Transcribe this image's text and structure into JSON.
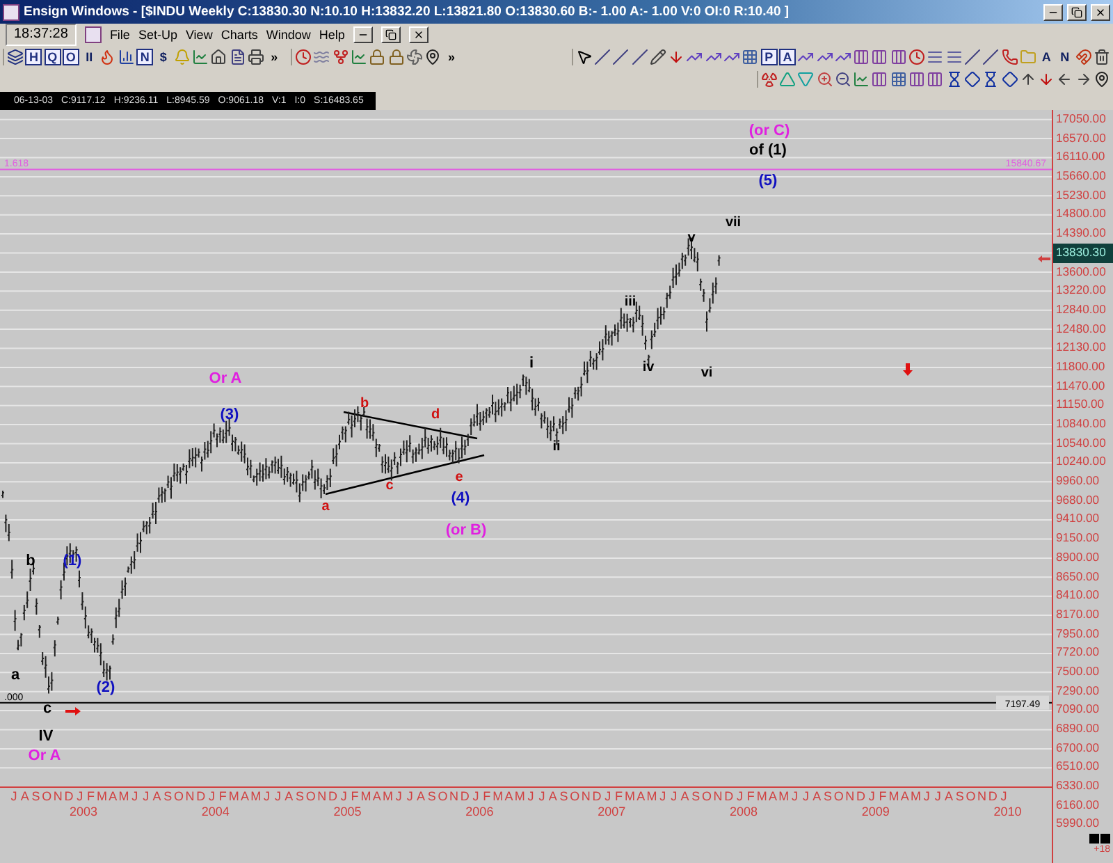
{
  "window": {
    "title": "Ensign Windows - [$INDU Weekly C:13830.30 N:10.10 H:13832.20 L:13821.80 O:13830.60 B:- 1.00 A:- 1.00 V:0 OI:0 R:10.40 ]"
  },
  "clock": "18:37:28",
  "menu": [
    "File",
    "Set-Up",
    "View",
    "Charts",
    "Window",
    "Help"
  ],
  "toolbar_1": [
    [
      {
        "kind": "window"
      },
      {
        "kind": "boxed-letter",
        "text": "H"
      },
      {
        "kind": "boxed-letter",
        "text": "Q"
      },
      {
        "kind": "boxed-letter",
        "text": "O"
      },
      {
        "kind": "letter",
        "text": "II"
      },
      {
        "kind": "flame"
      },
      {
        "kind": "bars"
      },
      {
        "kind": "boxed-letter",
        "text": "N"
      },
      {
        "kind": "letter",
        "text": "$"
      },
      {
        "kind": "bell"
      },
      {
        "kind": "chart"
      },
      {
        "kind": "home"
      },
      {
        "kind": "file"
      },
      {
        "kind": "printer"
      },
      {
        "kind": "more",
        "text": "»"
      }
    ],
    [
      {
        "kind": "clock"
      },
      {
        "kind": "waves"
      },
      {
        "kind": "fork"
      },
      {
        "kind": "chart"
      },
      {
        "kind": "lock"
      },
      {
        "kind": "lock"
      },
      {
        "kind": "fan"
      },
      {
        "kind": "pin"
      },
      {
        "kind": "more",
        "text": "»"
      }
    ],
    [
      {
        "kind": "cursor"
      },
      {
        "kind": "line"
      },
      {
        "kind": "line"
      },
      {
        "kind": "line"
      },
      {
        "kind": "pencil"
      },
      {
        "kind": "arrow-down"
      },
      {
        "kind": "trend"
      },
      {
        "kind": "trend"
      },
      {
        "kind": "trend"
      },
      {
        "kind": "grid"
      },
      {
        "kind": "boxed-letter",
        "text": "P"
      },
      {
        "kind": "boxed-letter",
        "text": "A"
      },
      {
        "kind": "trend"
      },
      {
        "kind": "trend"
      },
      {
        "kind": "trend"
      },
      {
        "kind": "columns"
      },
      {
        "kind": "columns"
      },
      {
        "kind": "columns"
      },
      {
        "kind": "clock"
      },
      {
        "kind": "lines"
      },
      {
        "kind": "lines"
      },
      {
        "kind": "line"
      },
      {
        "kind": "line"
      },
      {
        "kind": "phone"
      },
      {
        "kind": "folder"
      },
      {
        "kind": "letter",
        "text": "A"
      },
      {
        "kind": "letter",
        "text": "N"
      },
      {
        "kind": "magnet"
      },
      {
        "kind": "trash"
      }
    ]
  ],
  "toolbar_2": [
    {
      "kind": "radiation"
    },
    {
      "kind": "triangle-up"
    },
    {
      "kind": "triangle-down"
    },
    {
      "kind": "zoom-in"
    },
    {
      "kind": "zoom-out"
    },
    {
      "kind": "chart"
    },
    {
      "kind": "columns"
    },
    {
      "kind": "grid"
    },
    {
      "kind": "columns"
    },
    {
      "kind": "columns"
    },
    {
      "kind": "hourglass"
    },
    {
      "kind": "diamond"
    },
    {
      "kind": "hourglass"
    },
    {
      "kind": "diamond"
    },
    {
      "kind": "arrow-up"
    },
    {
      "kind": "arrow-down"
    },
    {
      "kind": "arrow-left"
    },
    {
      "kind": "arrow-right"
    },
    {
      "kind": "pin"
    }
  ],
  "info_strip": [
    "06-13-03",
    "C:9117.12",
    "H:9236.11",
    "L:8945.59",
    "O:9061.18",
    "V:1",
    "I:0",
    "S:16483.65"
  ],
  "levels": [
    {
      "kind": "fib",
      "left_label": "1.618",
      "right_label": "15840.67"
    },
    {
      "kind": "support",
      "left_label": ".000",
      "right_label": "7197.49"
    }
  ],
  "annotations": [
    {
      "text": "(or C)",
      "color": "#e020e0"
    },
    {
      "text": "of (1)",
      "color": "#000000"
    },
    {
      "text": "(5)",
      "color": "#1010c0"
    },
    {
      "text": "vii",
      "color": "#000000"
    },
    {
      "text": "v",
      "color": "#000000"
    },
    {
      "text": "iii",
      "color": "#000000"
    },
    {
      "text": "i",
      "color": "#000000"
    },
    {
      "text": "Or A",
      "color": "#e020e0"
    },
    {
      "text": "iv",
      "color": "#000000"
    },
    {
      "text": "vi",
      "color": "#000000"
    },
    {
      "text": "b",
      "color": "#d01010"
    },
    {
      "text": "(3)",
      "color": "#1010c0"
    },
    {
      "text": "d",
      "color": "#d01010"
    },
    {
      "text": "ii",
      "color": "#000000"
    },
    {
      "text": "e",
      "color": "#d01010"
    },
    {
      "text": "c",
      "color": "#d01010"
    },
    {
      "text": "(4)",
      "color": "#1010c0"
    },
    {
      "text": "a",
      "color": "#d01010"
    },
    {
      "text": "(or B)",
      "color": "#e020e0"
    },
    {
      "text": "b",
      "color": "#000000"
    },
    {
      "text": "(1)",
      "color": "#1010c0"
    },
    {
      "text": "a",
      "color": "#000000"
    },
    {
      "text": "(2)",
      "color": "#1010c0"
    },
    {
      "text": "c",
      "color": "#000000"
    },
    {
      "text": "IV",
      "color": "#000000"
    },
    {
      "text": "Or A",
      "color": "#e020e0"
    }
  ],
  "y_axis": [
    {
      "kind": "tick",
      "text": "17050.00"
    },
    {
      "kind": "tick",
      "text": "16570.00"
    },
    {
      "kind": "tick",
      "text": "16110.00"
    },
    {
      "kind": "tick",
      "text": "15660.00"
    },
    {
      "kind": "tick",
      "text": "15230.00"
    },
    {
      "kind": "tick",
      "text": "14800.00"
    },
    {
      "kind": "tick",
      "text": "14390.00"
    },
    {
      "kind": "current",
      "text": "13830.30"
    },
    {
      "kind": "tick",
      "text": "13600.00"
    },
    {
      "kind": "tick",
      "text": "13220.00"
    },
    {
      "kind": "tick",
      "text": "12840.00"
    },
    {
      "kind": "tick",
      "text": "12480.00"
    },
    {
      "kind": "tick",
      "text": "12130.00"
    },
    {
      "kind": "tick",
      "text": "11800.00"
    },
    {
      "kind": "tick",
      "text": "11470.00"
    },
    {
      "kind": "tick",
      "text": "11150.00"
    },
    {
      "kind": "tick",
      "text": "10840.00"
    },
    {
      "kind": "tick",
      "text": "10540.00"
    },
    {
      "kind": "tick",
      "text": "10240.00"
    },
    {
      "kind": "tick",
      "text": "9960.00"
    },
    {
      "kind": "tick",
      "text": "9680.00"
    },
    {
      "kind": "tick",
      "text": "9410.00"
    },
    {
      "kind": "tick",
      "text": "9150.00"
    },
    {
      "kind": "tick",
      "text": "8900.00"
    },
    {
      "kind": "tick",
      "text": "8650.00"
    },
    {
      "kind": "tick",
      "text": "8410.00"
    },
    {
      "kind": "tick",
      "text": "8170.00"
    },
    {
      "kind": "tick",
      "text": "7950.00"
    },
    {
      "kind": "tick",
      "text": "7720.00"
    },
    {
      "kind": "tick",
      "text": "7500.00"
    },
    {
      "kind": "tick",
      "text": "7290.00"
    },
    {
      "kind": "tick",
      "text": "7090.00"
    },
    {
      "kind": "tick",
      "text": "6890.00"
    },
    {
      "kind": "tick",
      "text": "6700.00"
    },
    {
      "kind": "tick",
      "text": "6510.00"
    },
    {
      "kind": "tick",
      "text": "6330.00"
    },
    {
      "kind": "tick",
      "text": "6160.00"
    },
    {
      "kind": "tick",
      "text": "5990.00"
    }
  ],
  "x_axis": {
    "months": [
      "J",
      "A",
      "S",
      "O",
      "N",
      "D",
      "J",
      "F",
      "M",
      "A",
      "M",
      "J",
      "J",
      "A",
      "S",
      "O",
      "N",
      "D",
      "J",
      "F",
      "M",
      "A",
      "M",
      "J",
      "J",
      "A",
      "S",
      "O",
      "N",
      "D",
      "J",
      "F",
      "M",
      "A",
      "M",
      "J",
      "J",
      "A",
      "S",
      "O",
      "N",
      "D",
      "J",
      "F",
      "M",
      "A",
      "M",
      "J",
      "J",
      "A",
      "S",
      "O",
      "N",
      "D",
      "J",
      "F",
      "M",
      "A",
      "M",
      "J",
      "J",
      "A",
      "S",
      "O",
      "N",
      "D",
      "J",
      "F",
      "M",
      "A",
      "M",
      "J",
      "J",
      "A",
      "S",
      "O",
      "N",
      "D",
      "J",
      "F",
      "M",
      "A",
      "M",
      "J",
      "J",
      "A",
      "S",
      "O",
      "N",
      "D",
      "J"
    ],
    "years": [
      "2003",
      "2004",
      "2005",
      "2006",
      "2007",
      "2008",
      "2009",
      "2010"
    ]
  },
  "corner_label": "+18"
}
